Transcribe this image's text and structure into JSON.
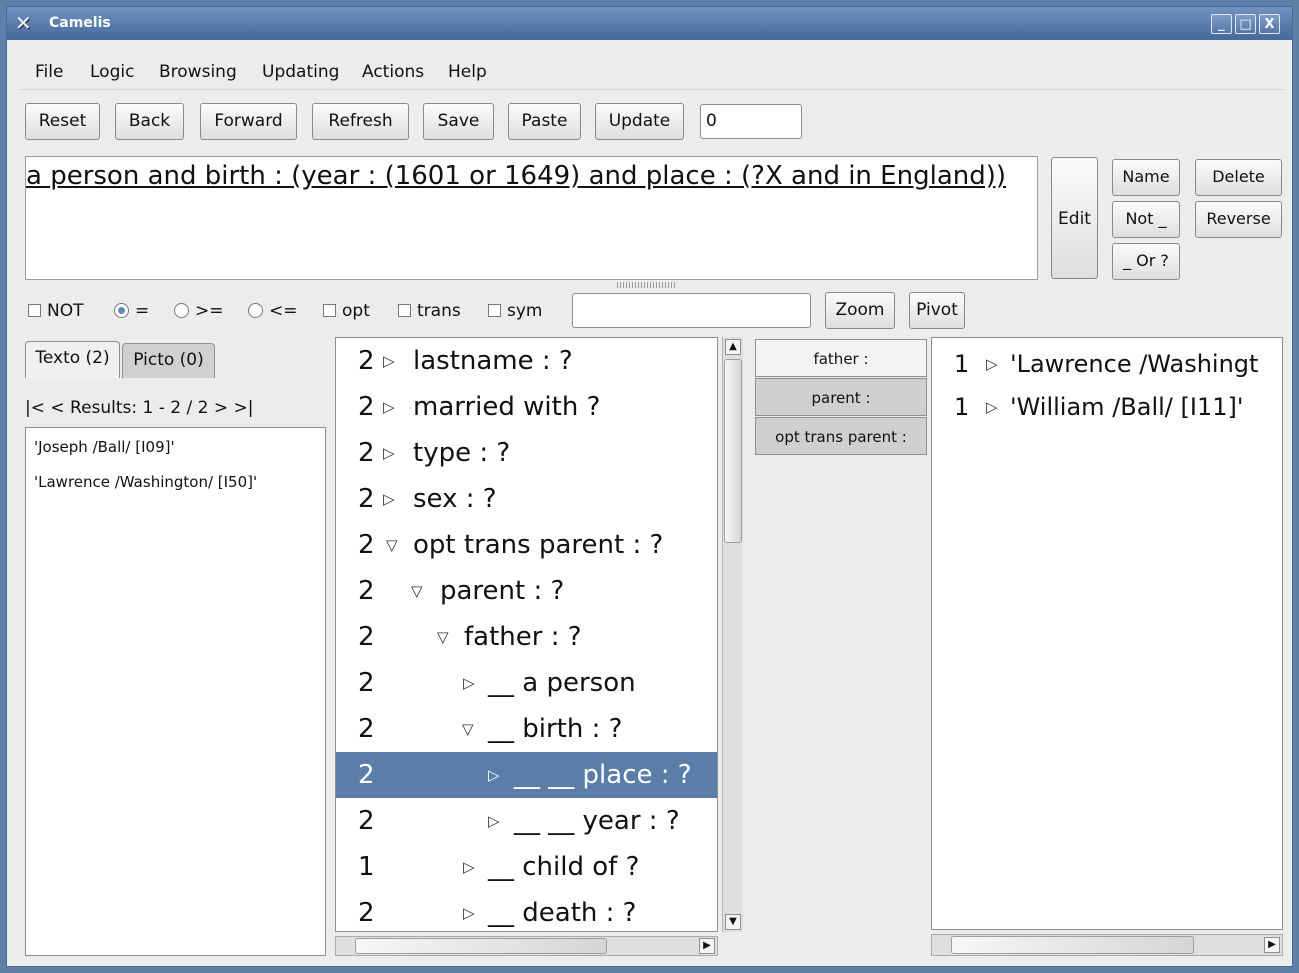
{
  "window": {
    "title": "Camelis",
    "controls": {
      "minimize": "_",
      "maximize": "□",
      "close": "X"
    },
    "app_icon": "x-icon"
  },
  "menu": [
    "File",
    "Logic",
    "Browsing",
    "Updating",
    "Actions",
    "Help"
  ],
  "toolbar": {
    "buttons": [
      "Reset",
      "Back",
      "Forward",
      "Refresh",
      "Save",
      "Paste",
      "Update"
    ],
    "update_value": "0"
  },
  "query": {
    "text": "a person and birth : (year : (1601 or 1649) and place : (?X and in England))"
  },
  "side_buttons": {
    "edit": "Edit",
    "name": "Name",
    "delete": "Delete",
    "not": "Not _",
    "reverse": "Reverse",
    "or": "_ Or ?"
  },
  "options": {
    "not": "NOT",
    "eq": "=",
    "ge": ">=",
    "le": "<=",
    "opt": "opt",
    "trans": "trans",
    "sym": "sym",
    "search_value": "",
    "zoom": "Zoom",
    "pivot": "Pivot"
  },
  "tabs": {
    "texto": "Texto (2)",
    "picto": "Picto (0)",
    "active": "Texto (2)"
  },
  "results": {
    "nav": "|<   < Results: 1 - 2 / 2 >   >|",
    "items": [
      "'Joseph /Ball/ [I09]'",
      "'Lawrence /Washington/ [I50]'"
    ]
  },
  "tree": [
    {
      "count": "2",
      "tri": "▷",
      "label": "lastname : ?"
    },
    {
      "count": "2",
      "tri": "▷",
      "label": "married with ?"
    },
    {
      "count": "2",
      "tri": "▷",
      "label": "type : ?"
    },
    {
      "count": "2",
      "tri": "▷",
      "label": "sex : ?"
    },
    {
      "count": "2",
      "tri": "▽",
      "label": "opt trans parent : ?"
    },
    {
      "count": "2",
      "tri": "▽",
      "label": "parent : ?"
    },
    {
      "count": "2",
      "tri": "▽",
      "label": "father : ?"
    },
    {
      "count": "2",
      "tri": "▷",
      "label": "__ a person"
    },
    {
      "count": "2",
      "tri": "▽",
      "label": "__ birth : ?"
    },
    {
      "count": "2",
      "tri": "▷",
      "label": "__ __ place : ?",
      "selected": true
    },
    {
      "count": "2",
      "tri": "▷",
      "label": "__ __ year : ?"
    },
    {
      "count": "1",
      "tri": "▷",
      "label": "__ child of ?"
    },
    {
      "count": "2",
      "tri": "▷",
      "label": "__ death : ?"
    }
  ],
  "roles": [
    "father :",
    "parent :",
    "opt trans parent :"
  ],
  "role_active": "father :",
  "values": [
    {
      "count": "1",
      "label": "'Lawrence /Washingt"
    },
    {
      "count": "1",
      "label": "'William /Ball/ [I11]'"
    }
  ]
}
